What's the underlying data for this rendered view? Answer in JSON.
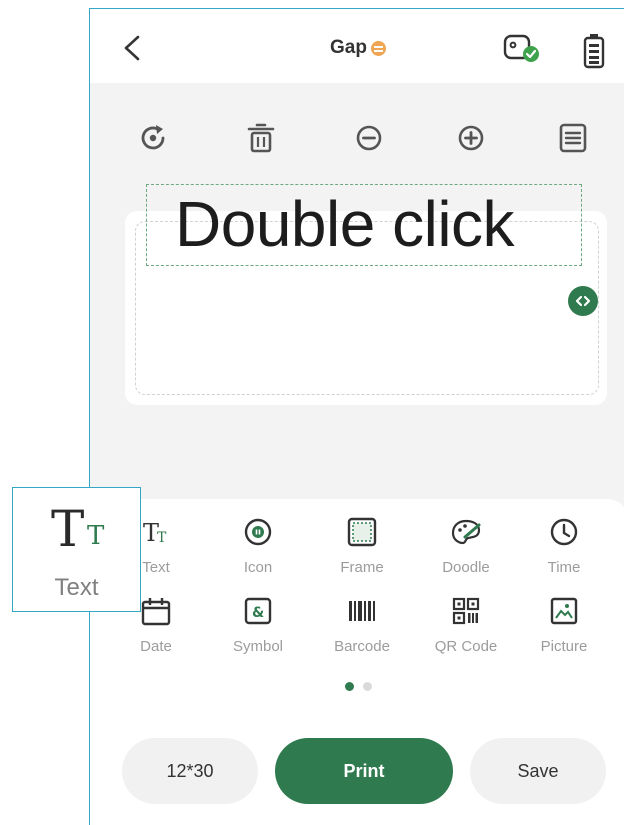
{
  "header": {
    "title": "Gap",
    "back_icon": "back-chevron-icon",
    "printer_icon": "printer-connected-icon",
    "battery_icon": "battery-icon"
  },
  "toolbar": {
    "icons": [
      "rotate-icon",
      "trash-icon",
      "zoom-out-icon",
      "zoom-in-icon",
      "align-icon"
    ]
  },
  "canvas": {
    "text": "Double click",
    "handle_icon": "resize-handle-icon"
  },
  "elements": {
    "items": [
      {
        "label": "Text",
        "icon": "text-icon"
      },
      {
        "label": "Icon",
        "icon": "icon-icon"
      },
      {
        "label": "Frame",
        "icon": "frame-icon"
      },
      {
        "label": "Doodle",
        "icon": "doodle-icon"
      },
      {
        "label": "Time",
        "icon": "clock-icon"
      },
      {
        "label": "Date",
        "icon": "calendar-icon"
      },
      {
        "label": "Symbol",
        "icon": "symbol-icon"
      },
      {
        "label": "Barcode",
        "icon": "barcode-icon"
      },
      {
        "label": "QR Code",
        "icon": "qr-code-icon"
      },
      {
        "label": "Picture",
        "icon": "picture-icon"
      }
    ],
    "page_count": 2,
    "active_page": 1
  },
  "actions": {
    "size_label": "12*30",
    "print_label": "Print",
    "save_label": "Save"
  },
  "callout": {
    "big_glyph": "T",
    "small_glyph": "T",
    "caption": "Text"
  },
  "colors": {
    "accent": "#2f7a4e",
    "highlight_border": "#35a7c6",
    "icon_gray": "#555555",
    "label_gray": "#9c9c9c"
  }
}
